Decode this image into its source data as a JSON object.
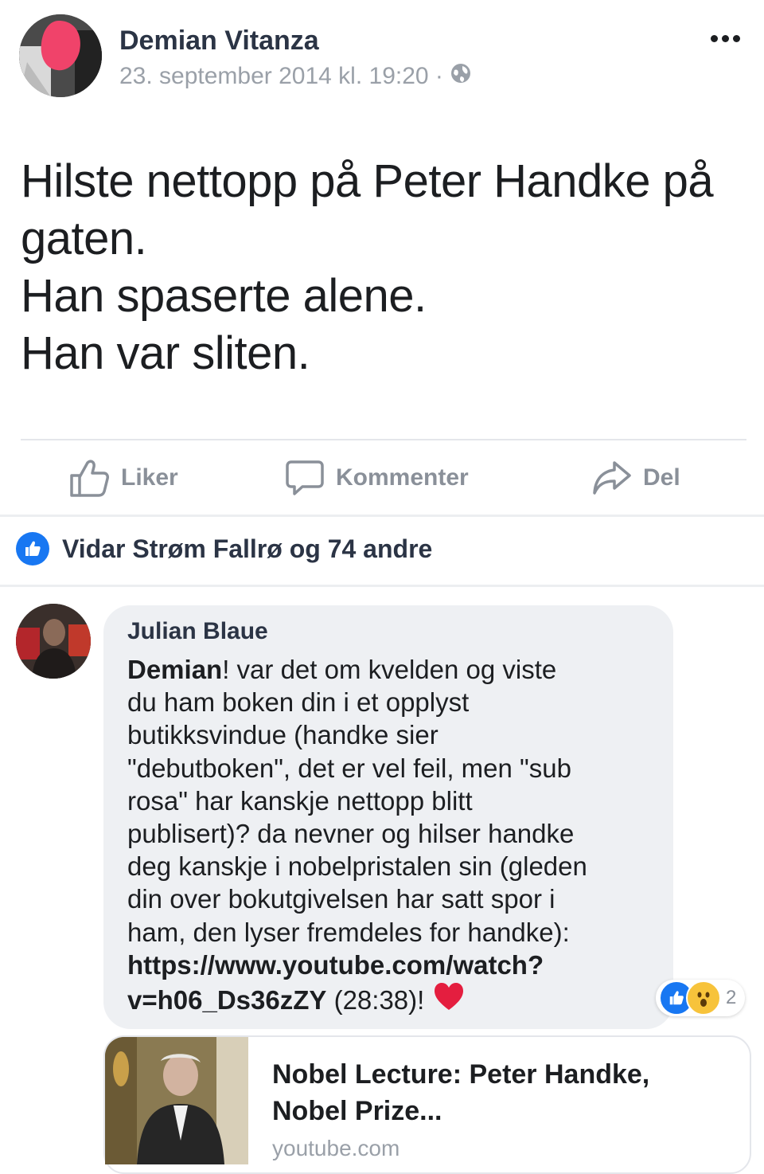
{
  "post": {
    "author": "Demian Vitanza",
    "timestamp": "23. september 2014 kl. 19:20 ·",
    "privacy_icon": "globe-icon",
    "more_icon": "more-options-icon",
    "text_lines": [
      "Hilste nettopp på Peter Handke på",
      "gaten.",
      "Han spaserte alene.",
      "Han var sliten."
    ]
  },
  "actions": {
    "like": "Liker",
    "comment": "Kommenter",
    "share": "Del"
  },
  "reactions": {
    "summary": "Vidar Strøm Fallrø og 74 andre"
  },
  "comment": {
    "author": "Julian Blaue",
    "lines": [
      {
        "bold": "Demian",
        "text": "! var det om kvelden og viste"
      },
      {
        "bold": "",
        "text": "du ham boken din i et opplyst"
      },
      {
        "bold": "",
        "text": "butikksvindue (handke sier"
      },
      {
        "bold": "",
        "text": "\"debutboken\", det er vel feil, men \"sub"
      },
      {
        "bold": "",
        "text": "rosa\" har kanskje nettopp blitt"
      },
      {
        "bold": "",
        "text": "publisert)? da nevner og hilser handke"
      },
      {
        "bold": "",
        "text": "deg kanskje i nobelpristalen sin (gleden"
      },
      {
        "bold": "",
        "text": "din over bokutgivelsen har satt spor i"
      },
      {
        "bold": "",
        "text": "ham, den lyser fremdeles for handke):"
      },
      {
        "bold": "https://www.youtube.com/watch?",
        "text": ""
      },
      {
        "bold": "v=h06_Ds36zZY",
        "text": " (28:38)! "
      }
    ],
    "reaction_count": "2",
    "heart_icon": "heart-icon"
  },
  "link_preview": {
    "title_lines": [
      "Nobel Lecture: Peter Handke,",
      "Nobel Prize..."
    ],
    "domain": "youtube.com"
  },
  "colors": {
    "accent": "#1877f2",
    "heart": "#e41e3f",
    "bubble": "#eef0f3",
    "muted": "#8a9099"
  }
}
